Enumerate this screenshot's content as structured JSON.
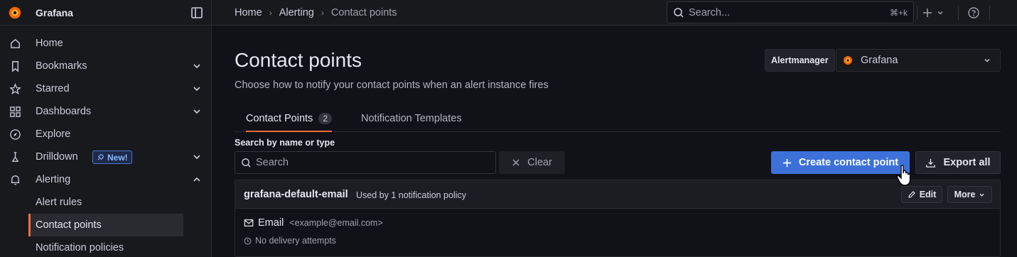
{
  "app": {
    "title": "Grafana",
    "accent": "#f56f3b",
    "primary": "#3d71d9"
  },
  "sidebar": {
    "items": [
      {
        "label": "Home",
        "icon": "home-icon"
      },
      {
        "label": "Bookmarks",
        "icon": "bookmark-icon"
      },
      {
        "label": "Starred",
        "icon": "star-icon"
      },
      {
        "label": "Dashboards",
        "icon": "apps-icon"
      },
      {
        "label": "Explore",
        "icon": "compass-icon"
      },
      {
        "label": "Drilldown",
        "icon": "drilldown-icon",
        "badge": "New!"
      },
      {
        "label": "Alerting",
        "icon": "bell-icon"
      }
    ],
    "subitems": [
      {
        "label": "Alert rules"
      },
      {
        "label": "Contact points",
        "active": true
      },
      {
        "label": "Notification policies"
      }
    ]
  },
  "topbar": {
    "breadcrumbs": [
      "Home",
      "Alerting",
      "Contact points"
    ],
    "search_placeholder": "Search...",
    "search_shortcut": "⌘+k"
  },
  "page": {
    "title": "Contact points",
    "subtitle": "Choose how to notify your contact points when an alert instance fires",
    "alertmanager_label": "Alertmanager",
    "alertmanager_value": "Grafana"
  },
  "tabs": [
    {
      "label": "Contact Points",
      "count": "2",
      "active": true
    },
    {
      "label": "Notification Templates"
    }
  ],
  "filter": {
    "label": "Search by name or type",
    "placeholder": "Search",
    "clear_label": "Clear"
  },
  "actions": {
    "create_label": "Create contact point",
    "export_label": "Export all"
  },
  "contact_point": {
    "name": "grafana-default-email",
    "usage": "Used by 1 notification policy",
    "edit_label": "Edit",
    "more_label": "More",
    "integration_name": "Email",
    "integration_address": "<example@email.com>",
    "delivery_status": "No delivery attempts"
  }
}
